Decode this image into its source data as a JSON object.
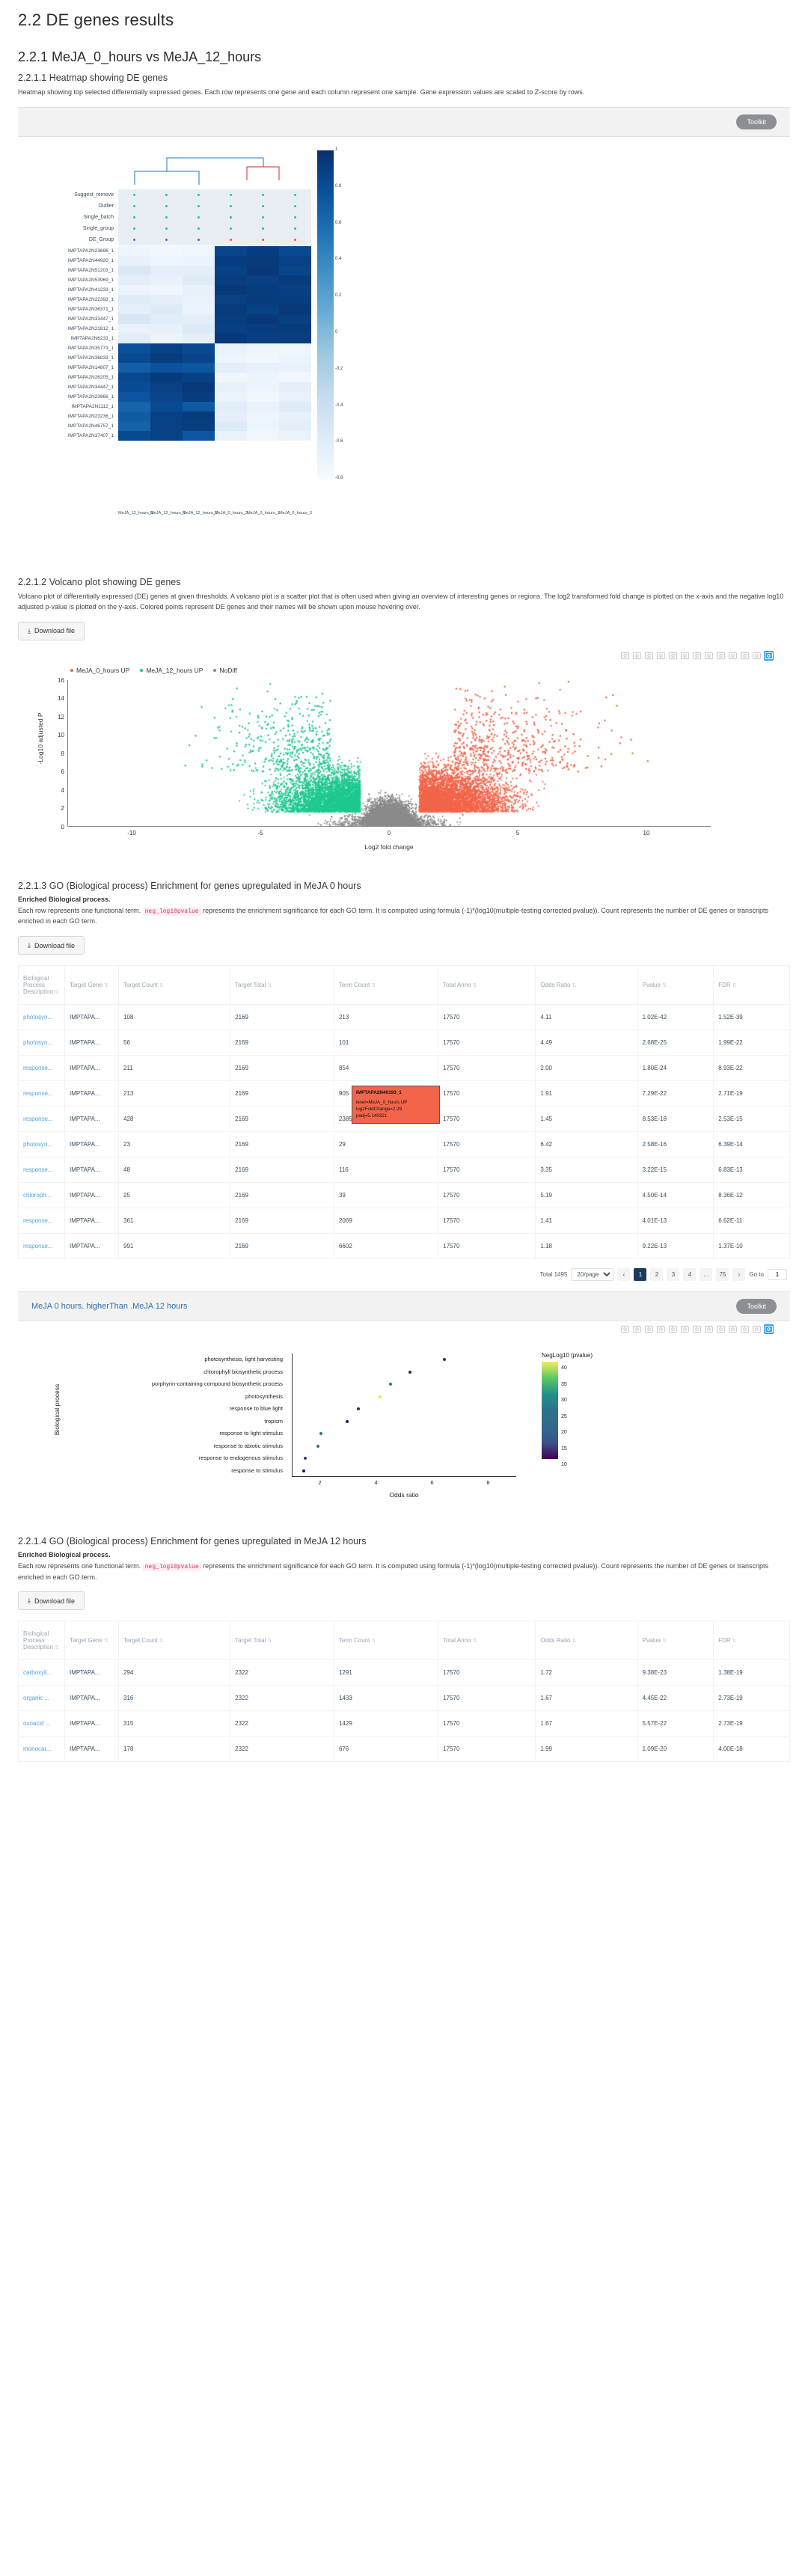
{
  "headings": {
    "h1": "2.2 DE genes results",
    "h2_1": "2.2.1 MeJA_0_hours vs MeJA_12_hours",
    "h3_heatmap": "2.2.1.1 Heatmap showing DE genes",
    "h3_volcano": "2.2.1.2 Volcano plot showing DE genes",
    "h3_go3": "2.2.1.3 GO (Biological process) Enrichment for genes upregulated in MeJA 0 hours",
    "h3_go4": "2.2.1.4 GO (Biological process) Enrichment for genes upregulated in MeJA 12 hours"
  },
  "descriptions": {
    "heatmap": "Heatmap showing top selected differentially expressed genes. Each row represents one gene and each column represent one sample. Gene expression values are scaled to Z-score by rows.",
    "volcano": "Volcano plot of differentially expressed (DE) genes at given thresholds. A volcano plot is a scatter plot that is often used when giving an overview of interesting genes or regions. The log2 transformed fold change is plotted on the x-axis and the negative log10 adjusted p-value is plotted on the y-axis. Colored points represent DE genes and their names will be shown upon mouse hovering over.",
    "go_lead": "Enriched Biological process.",
    "go_body_1": "Each row represents one functional term.",
    "go_code": "neg_log10pvalue",
    "go_body_2": "represents the enrichment significance for each GO term. It is computed using formula (-1)*(log10(multiple-testing corrected pvalue)). Count represents the number of DE genes or transcripts enriched in each GO term."
  },
  "buttons": {
    "toolkit": "Toolkit",
    "download": "Download file",
    "download_icon": "download-icon"
  },
  "panel_title": "MeJA 0 hours. higherThan .MeJA 12 hours",
  "colors": {
    "accent_blue": "#2f6fa8",
    "link_blue": "#4aa3e0",
    "up0": "#f2654a",
    "up12": "#1ec98f",
    "nodiff": "#8a8a8a",
    "toolkit_grey": "#8c8f94",
    "heat_high": "#08306b",
    "heat_low": "#f7fbff"
  },
  "heatmap": {
    "annotation_rows": [
      "Suggest_remove",
      "Outlier",
      "Single_batch",
      "Single_group",
      "DE_Group"
    ],
    "annotation_colors": [
      [
        "#1ec98f",
        "#1ec98f",
        "#1ec98f",
        "#1ec98f",
        "#1ec98f",
        "#1ec98f"
      ],
      [
        "#1ec98f",
        "#1ec98f",
        "#1ec98f",
        "#1ec98f",
        "#1ec98f",
        "#1ec98f"
      ],
      [
        "#1ec98f",
        "#1ec98f",
        "#1ec98f",
        "#1ec98f",
        "#1ec98f",
        "#1ec98f"
      ],
      [
        "#1ec98f",
        "#1ec98f",
        "#1ec98f",
        "#1ec98f",
        "#1ec98f",
        "#1ec98f"
      ],
      [
        "#5b5bd6",
        "#5b5bd6",
        "#5b5bd6",
        "#e8503a",
        "#e8503a",
        "#e8503a"
      ]
    ],
    "gene_rows": [
      "IMPTAPA2N23696_1",
      "IMPTAPA2N44920_1",
      "IMPTAPA2N51203_1",
      "IMPTAPA2N53969_1",
      "IMPTAPA2N41233_1",
      "IMPTAPA2N22393_1",
      "IMPTAPA2N36371_1",
      "IMPTAPA2N33447_1",
      "IMPTAPA2N21812_1",
      "IMPTAPA2N6233_1",
      "IMPTAPA2N35773_1",
      "IMPTAPA2N36833_1",
      "IMPTAPA2N14807_1",
      "IMPTAPA2N26205_1",
      "IMPTAPA2N34447_1",
      "IMPTAPA2N23666_1",
      "IMPTAPA2N1112_1",
      "IMPTAPA2N23236_1",
      "IMPTAPA2N46757_1",
      "IMPTAPA2N37407_1"
    ],
    "samples": [
      "MeJA_12_hours_3",
      "MeJA_12_hours_1",
      "MeJA_12_hours_2",
      "MeJA_0_hours_2",
      "MeJA_0_hours_1",
      "MeJA_0_hours_3"
    ],
    "colorbar_ticks": [
      "1",
      "0.8",
      "0.6",
      "0.4",
      "0.2",
      "0",
      "-0.2",
      "-0.4",
      "-0.6",
      "-0.8"
    ],
    "zvalues": [
      [
        0.05,
        0.02,
        0.04,
        0.92,
        0.95,
        0.9
      ],
      [
        0.08,
        0.05,
        0.06,
        0.95,
        0.96,
        0.93
      ],
      [
        0.14,
        0.1,
        0.09,
        0.93,
        0.97,
        0.92
      ],
      [
        0.1,
        0.07,
        0.12,
        0.95,
        0.94,
        0.96
      ],
      [
        0.06,
        0.04,
        0.08,
        0.97,
        0.95,
        0.94
      ],
      [
        0.12,
        0.09,
        0.07,
        0.94,
        0.96,
        0.95
      ],
      [
        0.09,
        0.13,
        0.06,
        0.96,
        0.93,
        0.97
      ],
      [
        0.16,
        0.11,
        0.1,
        0.95,
        0.97,
        0.94
      ],
      [
        0.07,
        0.08,
        0.13,
        0.94,
        0.95,
        0.96
      ],
      [
        0.11,
        0.06,
        0.09,
        0.97,
        0.94,
        0.95
      ],
      [
        0.88,
        0.93,
        0.9,
        0.07,
        0.05,
        0.04
      ],
      [
        0.9,
        0.95,
        0.92,
        0.05,
        0.03,
        0.06
      ],
      [
        0.82,
        0.87,
        0.85,
        0.1,
        0.08,
        0.07
      ],
      [
        0.91,
        0.96,
        0.93,
        0.04,
        0.06,
        0.03
      ],
      [
        0.89,
        0.94,
        0.97,
        0.08,
        0.05,
        0.09
      ],
      [
        0.86,
        0.92,
        0.95,
        0.06,
        0.04,
        0.07
      ],
      [
        0.8,
        0.9,
        0.84,
        0.11,
        0.07,
        0.12
      ],
      [
        0.83,
        0.93,
        0.96,
        0.09,
        0.05,
        0.08
      ],
      [
        0.81,
        0.94,
        0.95,
        0.13,
        0.06,
        0.1
      ],
      [
        0.9,
        0.93,
        0.85,
        0.07,
        0.04,
        0.06
      ]
    ]
  },
  "volcano": {
    "legend": [
      {
        "label": "MeJA_0_hours UP",
        "color": "#f2654a"
      },
      {
        "label": "MeJA_12_hours UP",
        "color": "#1ec98f"
      },
      {
        "label": "NoDiff",
        "color": "#8a8a8a"
      }
    ],
    "ylabel": "-Log10 adjusted P",
    "xlabel": "Log2 fold change",
    "yticks": [
      "16",
      "14",
      "12",
      "10",
      "8",
      "6",
      "4",
      "2",
      "0"
    ],
    "xticks": [
      "-10",
      "-5",
      "0",
      "5",
      "10"
    ],
    "ylim": [
      0,
      16
    ],
    "xlim": [
      -12,
      12
    ],
    "tooltip": {
      "gene": "IMPTAPA2N40193_1",
      "level": "level=MeJA_0_hours UP",
      "log2fc": "log2FoldChange=2.29",
      "padj": "padj=5.140321"
    }
  },
  "go_table_header": [
    {
      "label": "Biological Process Description",
      "sortable": true
    },
    {
      "label": "Target Gene",
      "sortable": true
    },
    {
      "label": "Target Count",
      "sortable": true
    },
    {
      "label": "Target Total",
      "sortable": true
    },
    {
      "label": "Term Count",
      "sortable": true
    },
    {
      "label": "Total Anno",
      "sortable": true
    },
    {
      "label": "Odds Ratio",
      "sortable": true
    },
    {
      "label": "Pvalue",
      "sortable": true
    },
    {
      "label": "FDR",
      "sortable": true
    }
  ],
  "go_table_1": {
    "rows": [
      [
        "photosyn...",
        "IMPTAPA...",
        "108",
        "2169",
        "213",
        "17570",
        "4.11",
        "1.02E-42",
        "1.52E-39"
      ],
      [
        "photosyn...",
        "IMPTAPA...",
        "56",
        "2169",
        "101",
        "17570",
        "4.49",
        "2.68E-25",
        "1.99E-22"
      ],
      [
        "response...",
        "IMPTAPA...",
        "211",
        "2169",
        "854",
        "17570",
        "2.00",
        "1.80E-24",
        "8.93E-22"
      ],
      [
        "response...",
        "IMPTAPA...",
        "213",
        "2169",
        "905",
        "17570",
        "1.91",
        "7.29E-22",
        "2.71E-19"
      ],
      [
        "response...",
        "IMPTAPA...",
        "428",
        "2169",
        "2385",
        "17570",
        "1.45",
        "8.53E-18",
        "2.53E-15"
      ],
      [
        "photosyn...",
        "IMPTAPA...",
        "23",
        "2169",
        "29",
        "17570",
        "6.42",
        "2.58E-16",
        "6.39E-14"
      ],
      [
        "response...",
        "IMPTAPA...",
        "48",
        "2169",
        "116",
        "17570",
        "3.35",
        "3.22E-15",
        "6.83E-13"
      ],
      [
        "chloroph...",
        "IMPTAPA...",
        "25",
        "2169",
        "39",
        "17570",
        "5.19",
        "4.50E-14",
        "8.36E-12"
      ],
      [
        "response...",
        "IMPTAPA...",
        "361",
        "2169",
        "2069",
        "17570",
        "1.41",
        "4.01E-13",
        "6.62E-11"
      ],
      [
        "response...",
        "IMPTAPA...",
        "991",
        "2169",
        "6602",
        "17570",
        "1.18",
        "9.22E-13",
        "1.37E-10"
      ]
    ]
  },
  "go_table_2": {
    "rows": [
      [
        "carboxyli...",
        "IMPTAPA...",
        "294",
        "2322",
        "1291",
        "17570",
        "1.72",
        "9.38E-23",
        "1.38E-19"
      ],
      [
        "organic ...",
        "IMPTAPA...",
        "316",
        "2322",
        "1433",
        "17570",
        "1.67",
        "4.45E-22",
        "2.73E-19"
      ],
      [
        "oxoacid ...",
        "IMPTAPA...",
        "315",
        "2322",
        "1429",
        "17570",
        "1.67",
        "5.57E-22",
        "2.73E-19"
      ],
      [
        "monocar...",
        "IMPTAPA...",
        "178",
        "2322",
        "676",
        "17570",
        "1.99",
        "1.09E-20",
        "4.00E-18"
      ]
    ]
  },
  "pagination": {
    "total_label": "Total 1495",
    "page_size": "20/page",
    "prev": "‹",
    "next": "›",
    "pages": [
      "1",
      "2",
      "3",
      "4",
      "…",
      "75"
    ],
    "active_page": "1",
    "goto_label": "Go to",
    "goto_value": "1"
  },
  "chart_data": {
    "type": "scatter",
    "title": "",
    "xlabel": "Odds ratio",
    "ylabel": "Biological process",
    "categories": [
      "photosynthesis, light harvesting",
      "chlorophyll biosynthetic process",
      "porphyrin-containing compound biosynthetic process",
      "photosynthesis",
      "response to blue light",
      "tropism",
      "response to light stimulus",
      "response to abiotic stimulus",
      "response to endogenous stimulus",
      "response to stimulus"
    ],
    "values": [
      6.42,
      5.19,
      4.49,
      4.11,
      3.35,
      2.95,
      2.0,
      1.91,
      1.45,
      1.41
    ],
    "colors": [
      14,
      12,
      22,
      39,
      13,
      11,
      21,
      19,
      15,
      10
    ],
    "xlim": [
      1,
      9
    ],
    "xticks": [
      2,
      4,
      6,
      8
    ],
    "legend_title": "NegLog10 (pvalue)",
    "legend_ticks": [
      "40",
      "35",
      "30",
      "25",
      "20",
      "15",
      "10"
    ],
    "legend_position": "right",
    "grid": false
  },
  "modebar_icons": [
    "camera-icon",
    "zoom-icon",
    "pan-icon",
    "box-select-icon",
    "lasso-select-icon",
    "zoom-in-icon",
    "zoom-out-icon",
    "autoscale-icon",
    "home-icon",
    "spike-lines-icon",
    "hover-compare-icon",
    "hover-closest-icon",
    "plotly-logo-icon"
  ]
}
